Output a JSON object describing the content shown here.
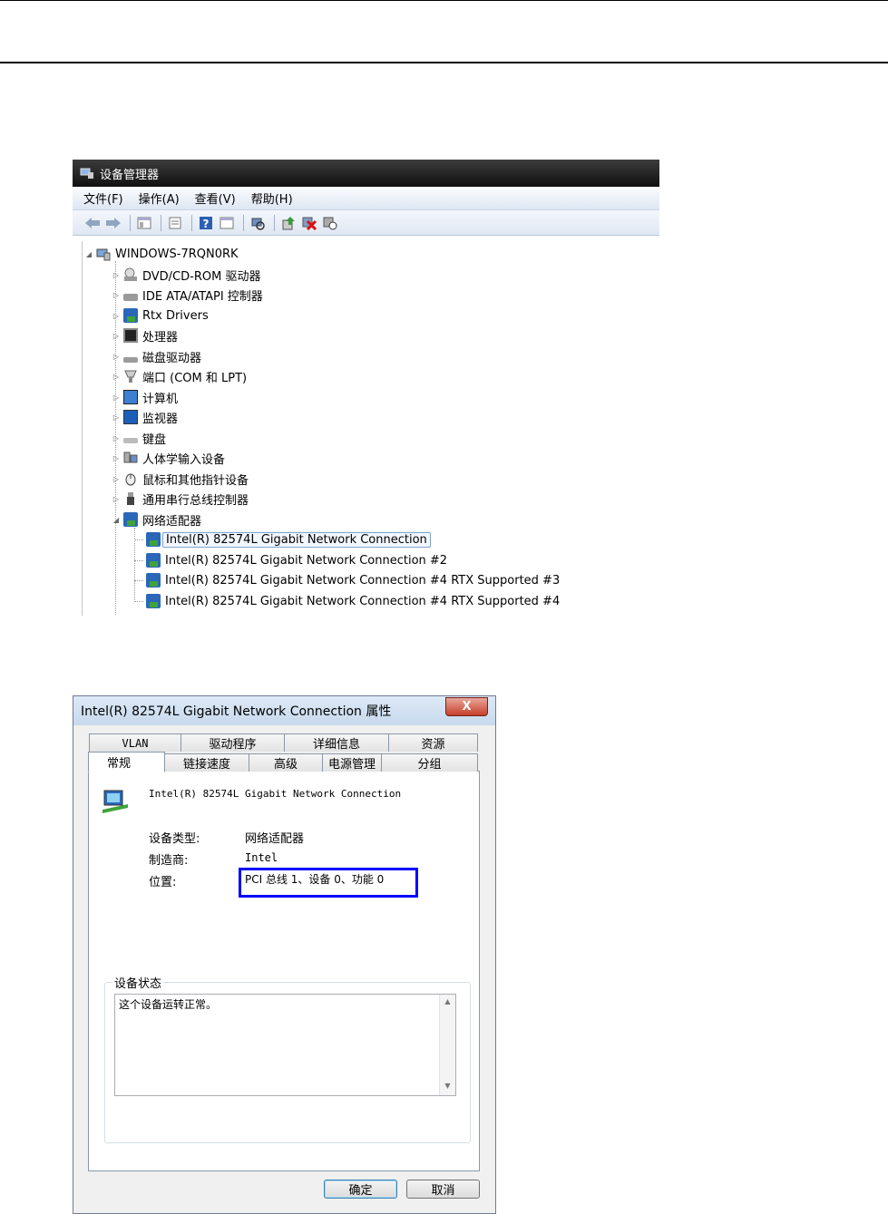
{
  "device_manager": {
    "title": "设备管理器",
    "menu": [
      "文件(F)",
      "操作(A)",
      "查看(V)",
      "帮助(H)"
    ],
    "toolbar_icons": [
      "back-icon",
      "forward-icon",
      "console-tree-icon",
      "properties-icon",
      "help-icon",
      "details-icon",
      "scan-hardware-icon",
      "update-driver-icon",
      "uninstall-icon",
      "disable-icon"
    ],
    "root": "WINDOWS-7RQN0RK",
    "categories": [
      "DVD/CD-ROM 驱动器",
      "IDE ATA/ATAPI 控制器",
      "Rtx Drivers",
      "处理器",
      "磁盘驱动器",
      "端口 (COM 和 LPT)",
      "计算机",
      "监视器",
      "键盘",
      "人体学输入设备",
      "鼠标和其他指针设备",
      "通用串行总线控制器",
      "网络适配器"
    ],
    "adapters": [
      "Intel(R) 82574L Gigabit Network Connection",
      "Intel(R) 82574L Gigabit Network Connection #2",
      "Intel(R) 82574L Gigabit Network Connection #4 RTX Supported #3",
      "Intel(R) 82574L Gigabit Network Connection #4 RTX Supported #4"
    ]
  },
  "properties_dialog": {
    "title": "Intel(R) 82574L Gigabit Network Connection 属性",
    "close_label": "X",
    "tabs_back": [
      "VLAN",
      "驱动程序",
      "详细信息",
      "资源"
    ],
    "tabs_front": [
      "常规",
      "链接速度",
      "高级",
      "电源管理",
      "分组"
    ],
    "device_name": "Intel(R) 82574L Gigabit Network Connection",
    "fields": {
      "type_label": "设备类型:",
      "type_value": "网络适配器",
      "mfr_label": "制造商:",
      "mfr_value": "Intel",
      "loc_label": "位置:",
      "loc_value": "PCI 总线 1、设备 0、功能 0"
    },
    "status_title": "设备状态",
    "status_text": "这个设备运转正常。",
    "highlight_color": "#0000ff",
    "ok_label": "确定",
    "cancel_label": "取消"
  }
}
